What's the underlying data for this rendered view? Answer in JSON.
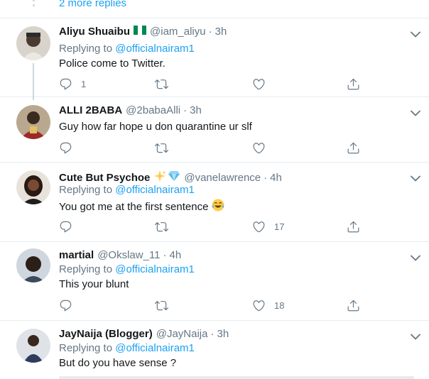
{
  "thread": {
    "more_replies": "2 more replies"
  },
  "replying_label": "Replying to",
  "tweets": [
    {
      "name": "Aliyu Shuaibu",
      "handle": "@iam_aliyu",
      "time": "3h",
      "badge": "nigeria-flag",
      "replying_to": "@officialnairam1",
      "text": "Police come to Twitter.",
      "reply_count": "1",
      "retweet_count": "",
      "like_count": ""
    },
    {
      "name": "ALLI 2BABA",
      "handle": "@2babaAlli",
      "time": "3h",
      "badge": "",
      "replying_to": "",
      "text": "Guy how far hope u don quarantine ur slf",
      "reply_count": "",
      "retweet_count": "",
      "like_count": ""
    },
    {
      "name": "Cute But Psychoe",
      "handle": "@vanelawrence",
      "time": "4h",
      "badge": "sparkles-gem",
      "replying_to": "@officialnairam1",
      "text": "You got me at the first sentence",
      "text_emoji": "joy-emoji",
      "reply_count": "",
      "retweet_count": "",
      "like_count": "17"
    },
    {
      "name": "martial",
      "handle": "@Okslaw_11",
      "time": "4h",
      "badge": "",
      "replying_to": "@officialnairam1",
      "text": "This your blunt",
      "reply_count": "",
      "retweet_count": "",
      "like_count": "18"
    },
    {
      "name": "JayNaija (Blogger)",
      "handle": "@JayNaija",
      "time": "3h",
      "badge": "",
      "replying_to": "@officialnairam1",
      "text": "But do you have sense ?",
      "reply_count": "",
      "retweet_count": "",
      "like_count": ""
    }
  ],
  "separator": "·",
  "colors": {
    "link": "#1da1f2",
    "secondary": "#657786",
    "text": "#14171a",
    "border": "#e6ecf0"
  }
}
